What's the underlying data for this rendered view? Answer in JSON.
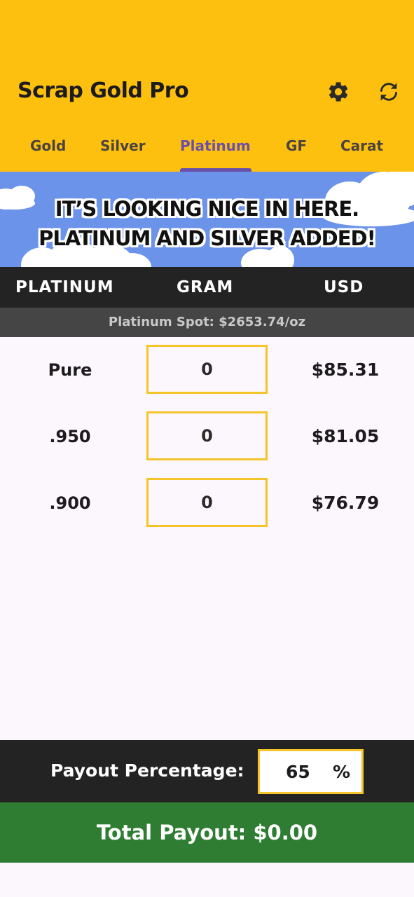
{
  "app": {
    "title": "Scrap Gold Pro",
    "settings_icon": "gear-icon",
    "refresh_icon": "refresh-icon"
  },
  "tabs": [
    {
      "label": "Gold",
      "active": false
    },
    {
      "label": "Silver",
      "active": false
    },
    {
      "label": "Platinum",
      "active": true
    },
    {
      "label": "GF",
      "active": false
    },
    {
      "label": "Carat",
      "active": false
    }
  ],
  "banner": {
    "line1": "IT’S LOOKING NICE IN HERE.",
    "line2": "PLATINUM AND SILVER ADDED!"
  },
  "columns": {
    "metal": "PLATINUM",
    "gram": "GRAM",
    "usd": "USD"
  },
  "spot_text": "Platinum Spot: $2653.74/oz",
  "rows": [
    {
      "purity": "Pure",
      "grams": "0",
      "usd": "$85.31"
    },
    {
      "purity": ".950",
      "grams": "0",
      "usd": "$81.05"
    },
    {
      "purity": ".900",
      "grams": "0",
      "usd": "$76.79"
    }
  ],
  "payout": {
    "label": "Payout Percentage:",
    "value": "65",
    "unit": "%"
  },
  "total": "Total Payout: $0.00",
  "colors": {
    "appbar": "#fec00f",
    "accent": "#6a50a8",
    "banner": "#6b93ea",
    "input_border": "#f4c42a",
    "header_bg": "#232323",
    "total_bg": "#2e7d32"
  }
}
